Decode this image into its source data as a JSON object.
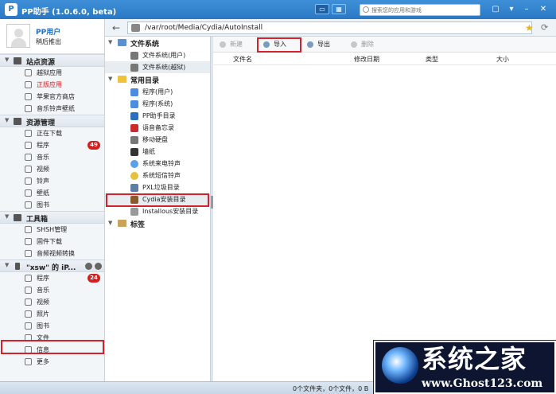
{
  "window": {
    "title": "PP助手 (1.0.6.0, beta)",
    "logo": "P",
    "search_placeholder": "搜索您的应用和游戏",
    "view_list": "▭",
    "view_grid": "▦"
  },
  "user": {
    "name": "PP用户",
    "status": "稍后推出"
  },
  "sidebar": {
    "sections": [
      {
        "title": "站点资源",
        "items": [
          {
            "label": "越狱应用"
          },
          {
            "label": "正版应用",
            "active": true
          },
          {
            "label": "苹果官方商店"
          },
          {
            "label": "音乐铃声壁纸"
          }
        ]
      },
      {
        "title": "资源管理",
        "items": [
          {
            "label": "正在下载"
          },
          {
            "label": "程序",
            "badge": "49"
          },
          {
            "label": "音乐"
          },
          {
            "label": "视频"
          },
          {
            "label": "铃声"
          },
          {
            "label": "壁纸"
          },
          {
            "label": "图书"
          }
        ]
      },
      {
        "title": "工具箱",
        "items": [
          {
            "label": "SHSH管理"
          },
          {
            "label": "固件下载"
          },
          {
            "label": "音频视频转换"
          }
        ]
      },
      {
        "title": "\"xsw\" 的 iP...",
        "items": [
          {
            "label": "程序",
            "badge": "24"
          },
          {
            "label": "音乐"
          },
          {
            "label": "视频"
          },
          {
            "label": "照片"
          },
          {
            "label": "图书"
          },
          {
            "label": "文件"
          },
          {
            "label": "信息"
          },
          {
            "label": "更多"
          }
        ]
      }
    ]
  },
  "path": "/var/root/Media/Cydia/AutoInstall",
  "tree": {
    "groups": [
      {
        "title": "文件系统",
        "items": [
          "文件系统(用户)",
          "文件系统(越狱)"
        ]
      },
      {
        "title": "常用目录",
        "items": [
          "程序(用户)",
          "程序(系统)",
          "PP助手目录",
          "语音备忘录",
          "移动硬盘",
          "墙纸",
          "系统来电铃声",
          "系统短信铃声",
          "PXL垃圾目录",
          "Cydia安装目录",
          "Installous安装目录"
        ]
      },
      {
        "title": "标签",
        "items": []
      }
    ]
  },
  "toolbar": {
    "new": "新建",
    "import": "导入",
    "export": "导出",
    "delete": "删除"
  },
  "columns": {
    "name": "文件名",
    "date": "修改日期",
    "type": "类型",
    "size": "大小"
  },
  "status": "0个文件夹，0个文件，0 B",
  "watermark": {
    "title": "系统之家",
    "url": "www.Ghost123.com"
  }
}
